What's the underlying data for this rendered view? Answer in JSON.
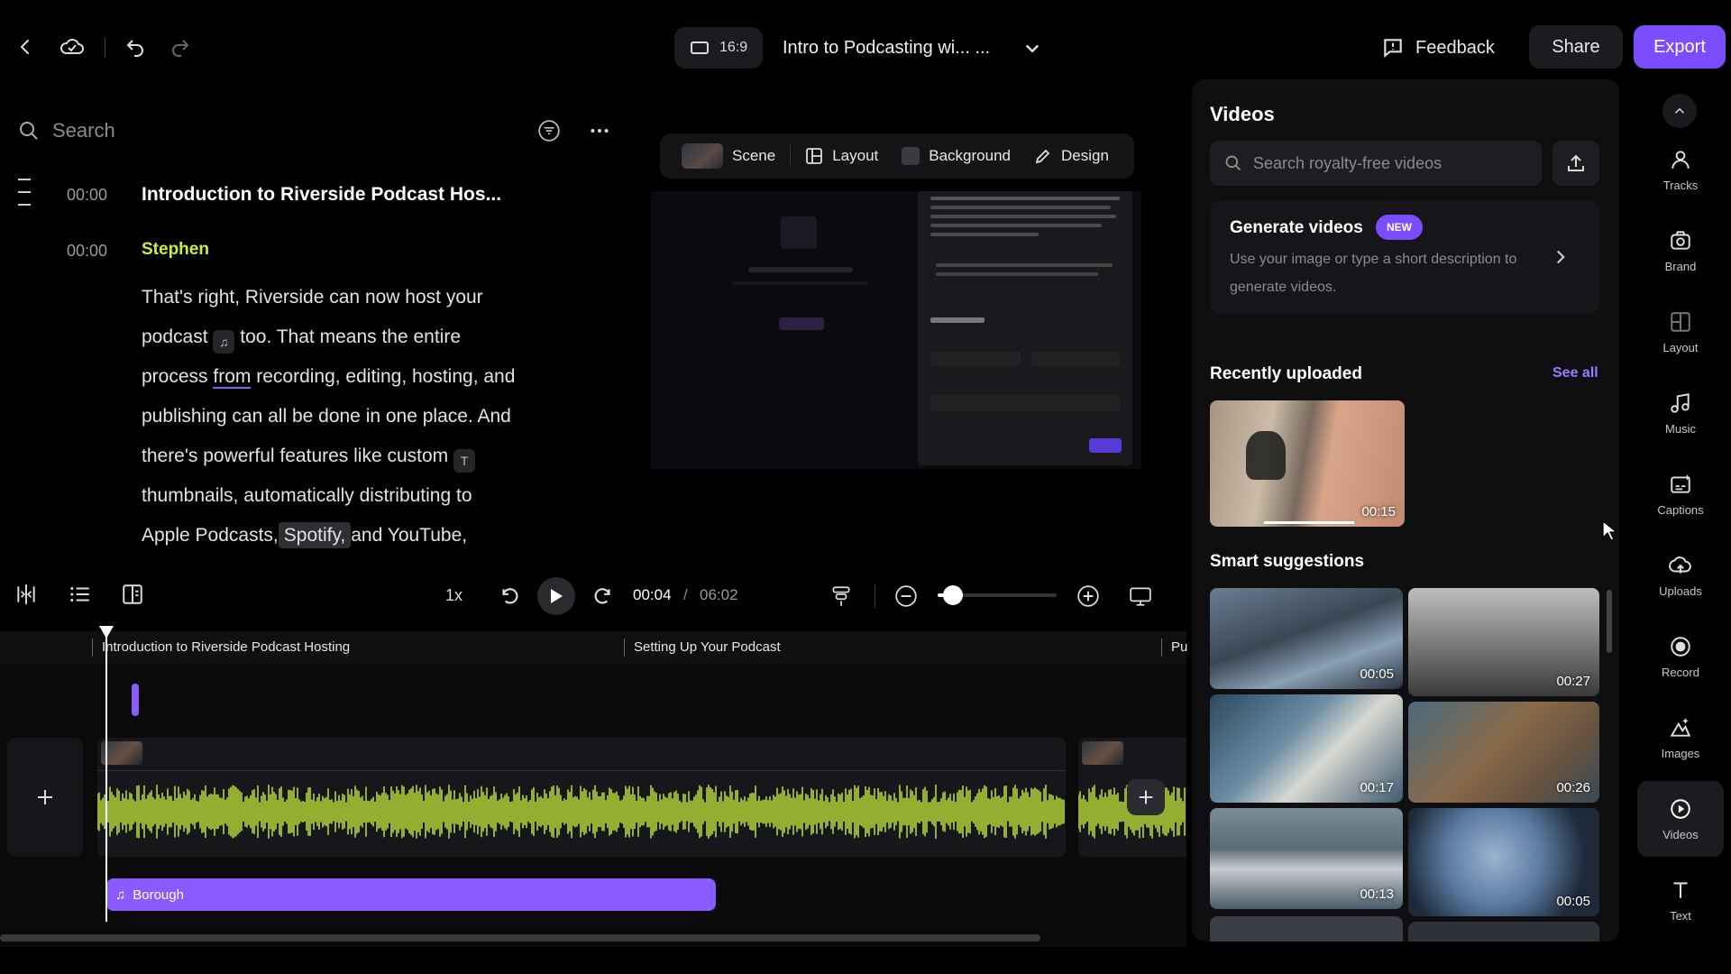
{
  "topbar": {
    "aspect_ratio": "16:9",
    "project_title": "Intro to Podcasting wi... ...",
    "feedback_label": "Feedback",
    "share_label": "Share",
    "export_label": "Export"
  },
  "transcript": {
    "search_placeholder": "Search",
    "entries": [
      {
        "time": "00:00",
        "title": "Introduction to Riverside Podcast Hos..."
      },
      {
        "time": "00:00",
        "speaker": "Stephen"
      }
    ],
    "body": {
      "p1": "That's right, Riverside can now host your",
      "p2a": "podcast",
      "p2b": "too. That means the entire",
      "p3a": "process",
      "p3b": "from",
      "p3c": "recording, editing, hosting, and",
      "p4": "publishing can all be done in one place. And",
      "p5": "there's powerful features like custom",
      "p6": "thumbnails, automatically distributing to",
      "p7a": "Apple Podcasts,",
      "p7b": "Spotify,",
      "p7c": "and YouTube,"
    }
  },
  "scene_bar": {
    "scene": "Scene",
    "layout": "Layout",
    "background": "Background",
    "design": "Design"
  },
  "playback": {
    "speed": "1x",
    "current_time": "00:04",
    "separator": "/",
    "total_time": "06:02",
    "zoom_level": 0.1
  },
  "timeline": {
    "chapters": [
      "Introduction to Riverside Podcast Hosting",
      "Setting Up Your Podcast",
      "Pu"
    ],
    "music_clip": "Borough"
  },
  "panel": {
    "title": "Videos",
    "search_placeholder": "Search royalty-free videos",
    "generate": {
      "title": "Generate videos",
      "badge": "NEW",
      "description": "Use your image or type a short description to generate videos."
    },
    "recent": {
      "title": "Recently uploaded",
      "see_all": "See all",
      "items": [
        {
          "duration": "00:15"
        }
      ]
    },
    "smart": {
      "title": "Smart suggestions",
      "items": [
        {
          "duration": "00:05"
        },
        {
          "duration": "00:27"
        },
        {
          "duration": "00:17"
        },
        {
          "duration": "00:26"
        },
        {
          "duration": "00:13"
        },
        {
          "duration": "00:05"
        }
      ]
    }
  },
  "rail": {
    "items": [
      {
        "label": "Tracks",
        "icon": "tracks-icon"
      },
      {
        "label": "Brand",
        "icon": "brand-icon"
      },
      {
        "label": "Layout",
        "icon": "layout-icon"
      },
      {
        "label": "Music",
        "icon": "music-icon"
      },
      {
        "label": "Captions",
        "icon": "captions-icon"
      },
      {
        "label": "Uploads",
        "icon": "uploads-icon"
      },
      {
        "label": "Record",
        "icon": "record-icon"
      },
      {
        "label": "Images",
        "icon": "images-icon"
      },
      {
        "label": "Videos",
        "icon": "videos-icon"
      },
      {
        "label": "Text",
        "icon": "text-icon"
      }
    ],
    "active": "Videos"
  },
  "colors": {
    "accent": "#7b4dff",
    "waveform": "#c9f03a",
    "speaker": "#c9f03a"
  }
}
